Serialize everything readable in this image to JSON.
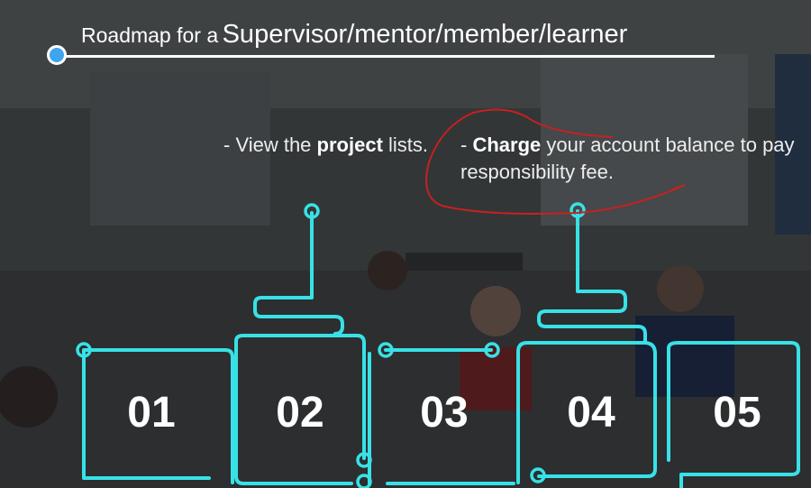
{
  "header": {
    "title_prefix": "Roadmap for a",
    "title_main": "Supervisor/mentor/member/learner"
  },
  "notes": [
    {
      "dash": "- View the ",
      "bold": "project",
      "rest": " lists."
    },
    {
      "dash": "- ",
      "bold": "Charge",
      "rest": " your account balance to pay responsibility fee."
    }
  ],
  "steps": [
    "01",
    "02",
    "03",
    "04",
    "05"
  ],
  "colors": {
    "accent": "#38e1e6",
    "dot": "#40a4ef",
    "annotation": "#c9201f"
  }
}
